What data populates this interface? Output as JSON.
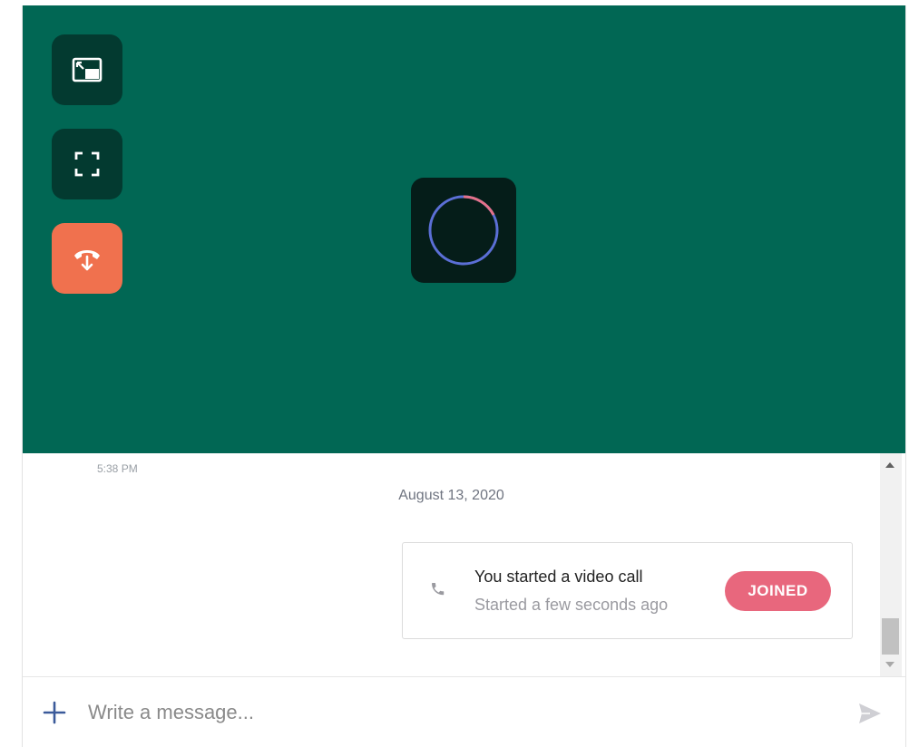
{
  "video": {
    "controls": [
      {
        "name": "pip-icon"
      },
      {
        "name": "fullscreen-icon"
      },
      {
        "name": "hangup-icon"
      }
    ],
    "loader_ring_color": "#5b6fd6",
    "loader_accent_color": "#e4728a"
  },
  "chat": {
    "timestamp": "5:38 PM",
    "date_divider": "August 13, 2020",
    "call_card": {
      "icon": "phone-icon",
      "title": "You started a video call",
      "subtitle": "Started a few seconds ago",
      "badge": "JOINED"
    }
  },
  "composer": {
    "placeholder": "Write a message...",
    "add_icon": "plus-icon",
    "send_icon": "send-icon"
  },
  "colors": {
    "video_bg": "#016754",
    "control_bg": "#033a30",
    "hangup_bg": "#f0714e",
    "badge_bg": "#e8677d",
    "accent_blue": "#3b5a9a"
  }
}
